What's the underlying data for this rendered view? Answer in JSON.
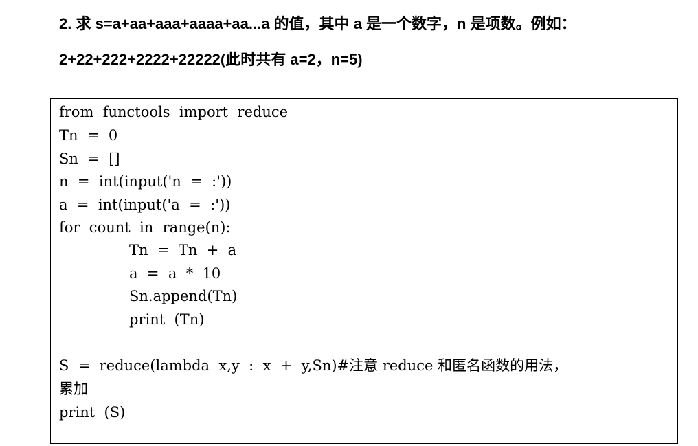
{
  "question": {
    "line1": "2. 求 s=a+aa+aaa+aaaa+aa...a 的值，其中 a 是一个数字，n 是项数。例如：",
    "line2": "2+22+222+2222+22222(此时共有 a=2，n=5)"
  },
  "code": {
    "lines": [
      "from  functools  import  reduce",
      "Tn  =  0",
      "Sn  =  []",
      "n  =  int(input('n  =  :'))",
      "a  =  int(input('a  =  :'))",
      "for  count  in  range(n):",
      "Tn  =  Tn  +  a",
      "a  =  a  *  10",
      "Sn.append(Tn)",
      "print  (Tn)",
      "",
      "S  =  reduce(lambda  x,y  :  x  +  y,Sn)#注意 reduce 和匿名函数的用法，",
      "累加",
      "print  (S)"
    ]
  }
}
